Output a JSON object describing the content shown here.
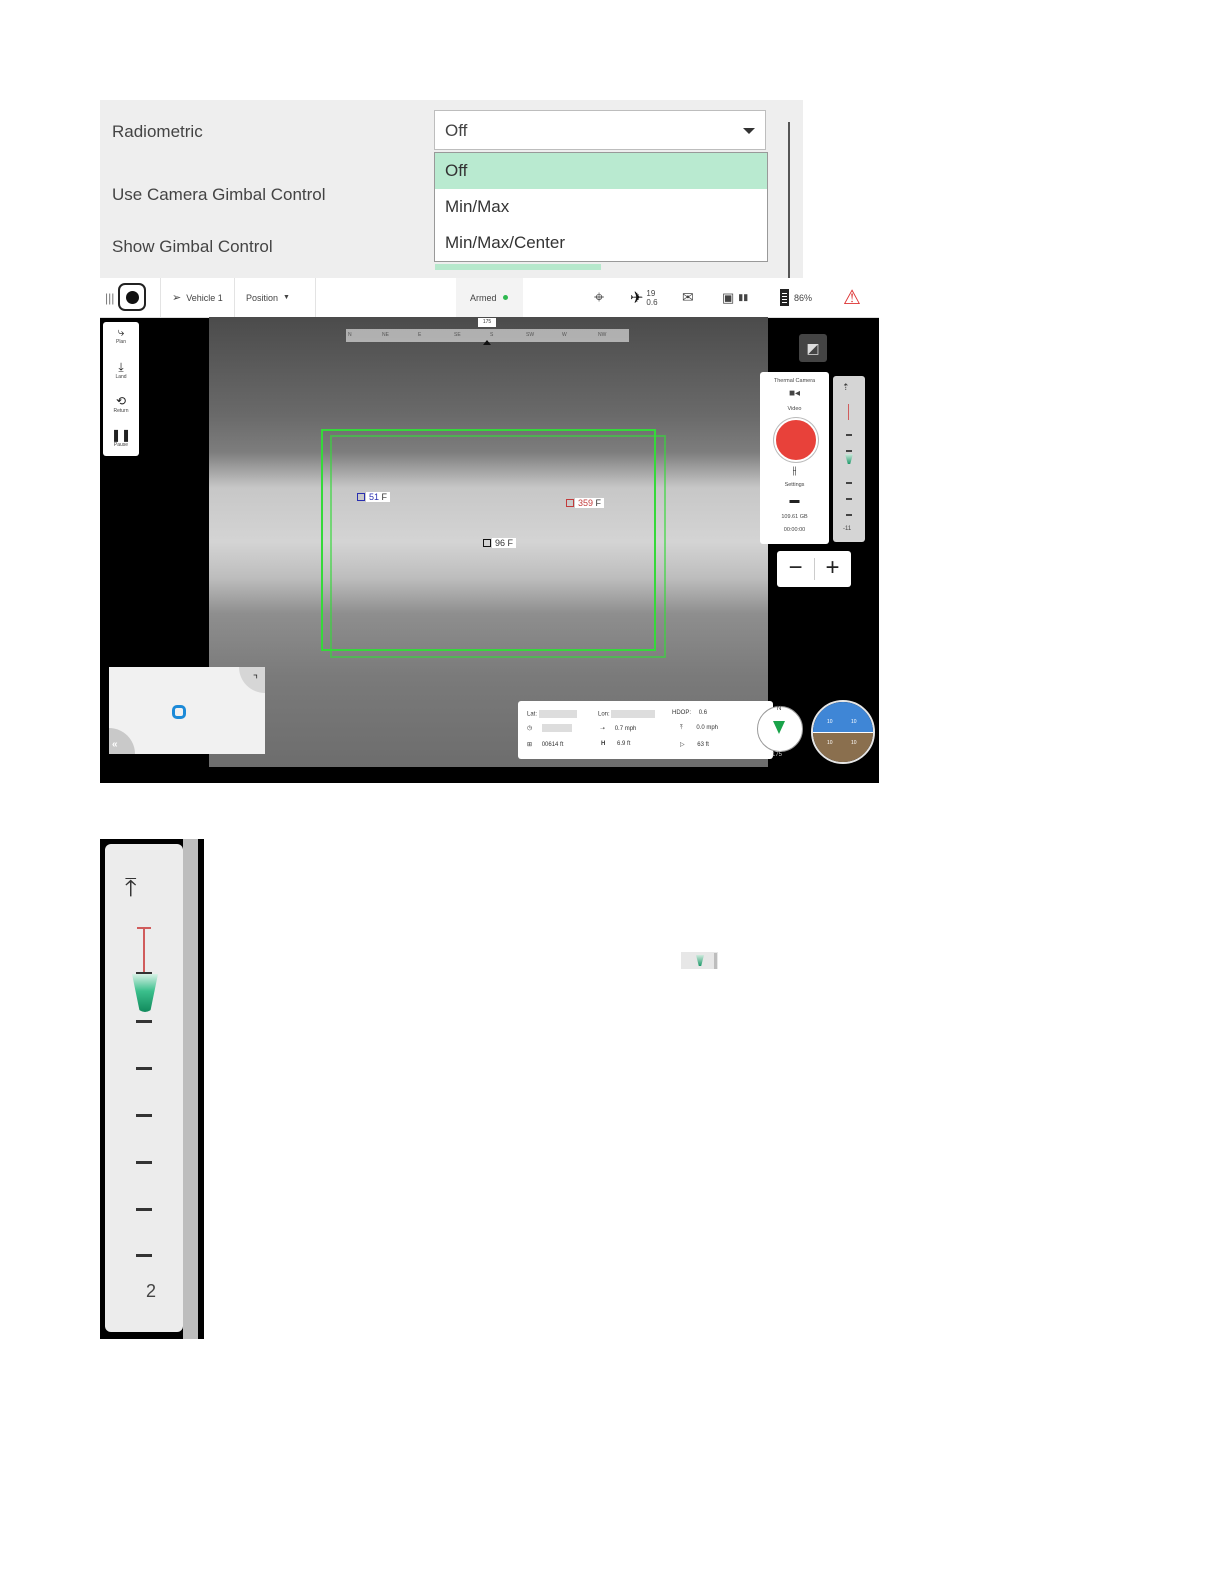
{
  "settings": {
    "rows": {
      "radiometric": "Radiometric",
      "gimbal_control": "Use Camera Gimbal Control",
      "show_gimbal": "Show Gimbal Control"
    },
    "radiometric_select": {
      "value": "Off",
      "options": [
        "Off",
        "Min/Max",
        "Min/Max/Center"
      ]
    }
  },
  "app": {
    "topbar": {
      "vehicle": "Vehicle 1",
      "mode": "Position",
      "status": "Armed",
      "satellites": "19",
      "hdop_top": "0.6",
      "battery": "86%"
    },
    "left_tools": [
      "Plan",
      "Land",
      "Return",
      "Pause"
    ],
    "compass_tape": {
      "heading": "175",
      "marks": [
        "N",
        "NE",
        "E",
        "SE",
        "S",
        "SW",
        "W",
        "NW"
      ]
    },
    "spots": [
      {
        "value": "51",
        "unit": "F"
      },
      {
        "value": "359",
        "unit": "F"
      },
      {
        "value": "96",
        "unit": "F"
      }
    ],
    "camera_panel": {
      "title": "Thermal Camera",
      "mode": "Video",
      "settings": "Settings",
      "storage": "109.61 GB",
      "elapsed": "00:00:00"
    },
    "gimbal_mini_value": "-11",
    "telemetry": {
      "lat_label": "Lat:",
      "lon_label": "Lon:",
      "hdop_label": "HDOP:",
      "hdop_value": "0.6",
      "time_value": "00614 ft",
      "hspeed": "0.7 mph",
      "vspeed": "0.0 mph",
      "height": "6.9 ft",
      "dist": "63 ft"
    },
    "compass_dial": {
      "north": "N",
      "heading": "175"
    },
    "attitude": {
      "pitch_up": "10",
      "pitch_down": "10"
    }
  },
  "gimbal_crop": {
    "value": "2"
  },
  "colors": {
    "selected_option": "#b9ead0",
    "record": "#e8413a",
    "roi": "#35d93a",
    "gimbal_cone": "#118a5c"
  }
}
